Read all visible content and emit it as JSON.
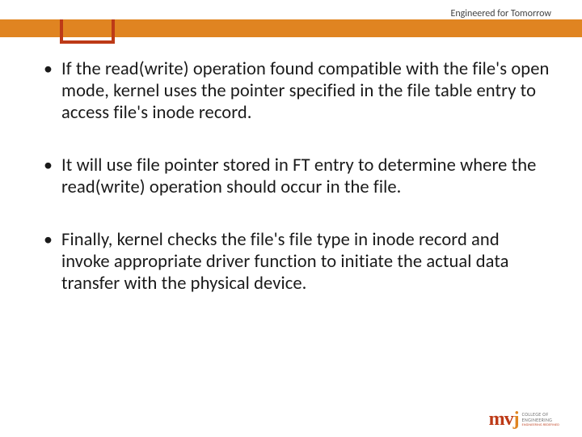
{
  "header": {
    "tagline": "Engineered for Tomorrow"
  },
  "bullets": [
    "If the read(write) operation found compatible with the file's open mode, kernel uses the pointer specified in the file table entry to access file's inode record.",
    "It  will use file pointer stored in FT entry to determine where the read(write) operation should occur in the file.",
    "Finally, kernel checks the file's file type in inode record and invoke appropriate driver function to initiate the actual data transfer with the physical device."
  ],
  "logo": {
    "mark": "mvj",
    "line1": "COLLEGE OF",
    "line2": "ENGINEERING",
    "sub": "ENGINEERING REDEFINED"
  }
}
